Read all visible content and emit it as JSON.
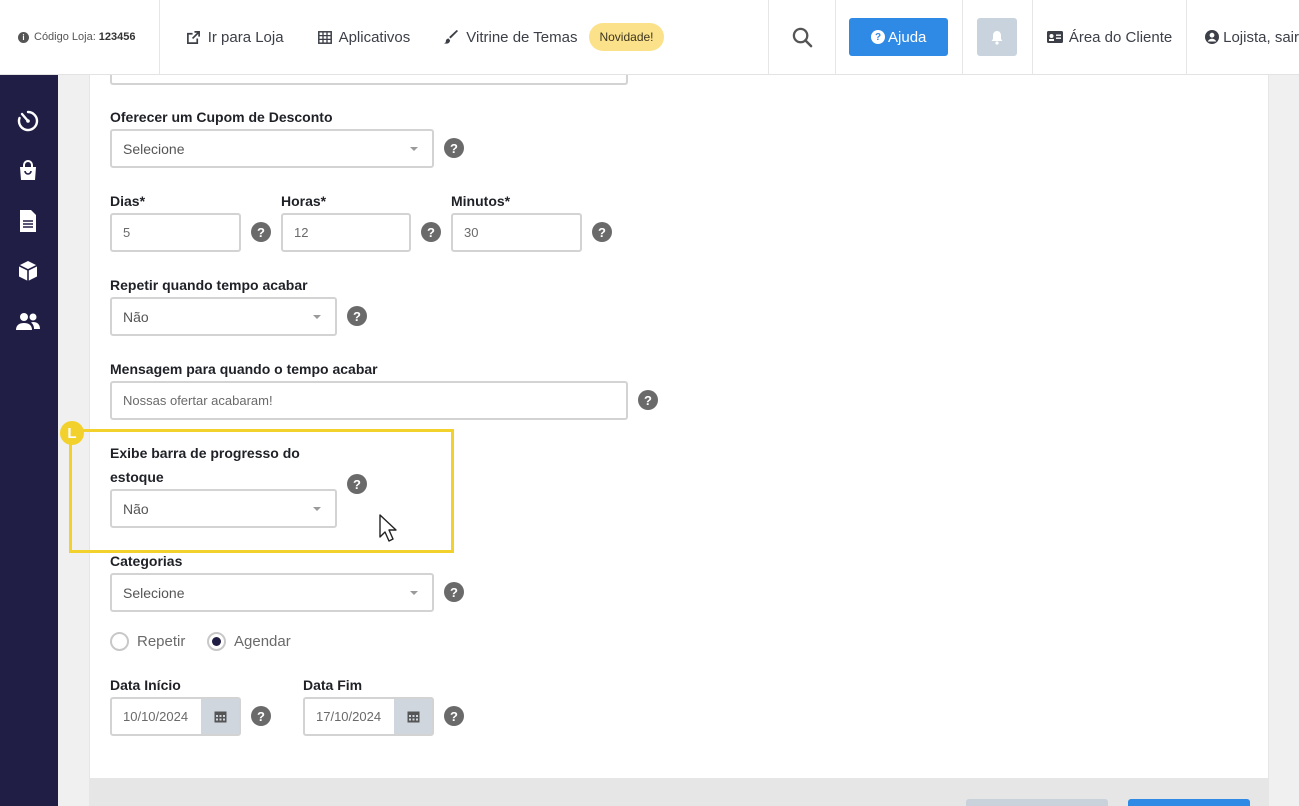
{
  "topbar": {
    "codigo_label": "Código Loja:",
    "codigo_value": "123456",
    "ir_para_loja": "Ir para Loja",
    "aplicativos": "Aplicativos",
    "vitrine": "Vitrine de Temas",
    "novidade": "Novidade!",
    "ajuda": "Ajuda",
    "area_cliente": "Área do Cliente",
    "lojista": "Lojista, sair"
  },
  "form": {
    "cupom": {
      "label": "Oferecer um Cupom de Desconto",
      "value": "Selecione"
    },
    "dias": {
      "label": "Dias*",
      "value": "5"
    },
    "horas": {
      "label": "Horas*",
      "value": "12"
    },
    "minutos": {
      "label": "Minutos*",
      "value": "30"
    },
    "repetir_tempo": {
      "label": "Repetir quando tempo acabar",
      "value": "Não"
    },
    "mensagem": {
      "label": "Mensagem para quando o tempo acabar",
      "value": "Nossas ofertar acabaram!"
    },
    "barra_progresso": {
      "label_line1": "Exibe barra de progresso do",
      "label_line2": "estoque",
      "value": "Não"
    },
    "categorias": {
      "label": "Categorias",
      "value": "Selecione"
    },
    "radio_repetir": "Repetir",
    "radio_agendar": "Agendar",
    "data_inicio": {
      "label": "Data Início",
      "value": "10/10/2024"
    },
    "data_fim": {
      "label": "Data Fim",
      "value": "17/10/2024"
    }
  },
  "highlight_marker": "L",
  "help_glyph": "?",
  "colors": {
    "sidebar": "#201e44",
    "accent": "#2f8ae5",
    "highlight": "#f3d12c",
    "badge": "#fbe28a"
  }
}
